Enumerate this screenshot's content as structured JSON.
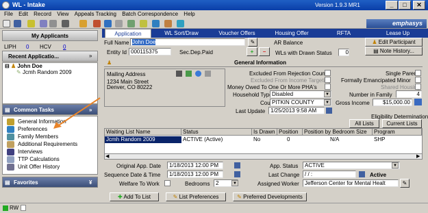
{
  "window": {
    "title": "WL - Intake",
    "version": "Version 1.9.3 MR1"
  },
  "menu": [
    "File",
    "Edit",
    "Record",
    "View",
    "Appeals Tracking",
    "Batch Correspondence",
    "Help"
  ],
  "brand": "emphasys",
  "left": {
    "my_applicants": "My Applicants",
    "counts": {
      "liph_label": "LIPH",
      "liph_value": "0",
      "hcv_label": "HCV",
      "hcv_value": "0"
    },
    "recent": "Recent Applicatio...",
    "tree": {
      "parent": "John Doe",
      "child": "Jcmh Random 2009"
    },
    "common_tasks": "Common Tasks",
    "tasks": [
      "General Information",
      "Preferences",
      "Family Members",
      "Additional Requirements",
      "Interviews",
      "TTP Calculations",
      "Unit Offer History"
    ],
    "favorites": "Favorites"
  },
  "tabs": [
    "Application",
    "WL Sort/Draw",
    "Voucher Offers",
    "Housing Offer",
    "RFTA",
    "Lease Up"
  ],
  "header": {
    "full_name_label": "Full Name",
    "full_name": "John Doe",
    "ar_balance": "AR Balance",
    "edit_participant": "Edit Participant",
    "entity_id_label": "Entity Id",
    "entity_id": "000115375",
    "sec_dep": "Sec.Dep.Paid",
    "wls_label": "WLs with Drawn Status",
    "wls_value": "0",
    "note_history": "Note History..."
  },
  "general": {
    "title": "General Information",
    "mailing_address": "Mailing Address",
    "address1": "1234 Main Street",
    "address2": "Denver, CO  80222",
    "excluded_rejection": "Excluded From Rejection Count",
    "excluded_income": "Excluded From Income Targeting",
    "money_owed": "Money Owed To One Or More PHA's",
    "household_type_label": "Household Type",
    "household_type": "Disabled",
    "county_label": "County",
    "county": "PITKIN COUNTY",
    "last_update_label": "Last Update",
    "last_update": "1/25/2013  9:58 AM",
    "single_parent": "Single Parent",
    "emancipated": "Formally Emancipated Minor",
    "shared_housing": "Shared Housing",
    "num_family_label": "Number in Family",
    "num_family": "4",
    "gross_income_label": "Gross Income",
    "gross_income": "$15,000.00",
    "eligibility": "Eligibility Determination",
    "all_lists": "All Lists",
    "current_lists": "Current Lists"
  },
  "grid": {
    "headers": [
      "Waiting List Name",
      "Status",
      "Is Drawn",
      "Position",
      "Position by Bedroom Size",
      "Program"
    ],
    "rows": [
      [
        "Jcmh Random 2009",
        "ACTIVE (Active)",
        "No",
        "0",
        "N/A",
        "SHP"
      ]
    ]
  },
  "bottom": {
    "orig_app_label": "Original App. Date",
    "orig_app": "1/18/2013 12:00 PM",
    "seq_label": "Sequence Date & Time",
    "seq": "1/18/2013 12:00 PM",
    "welfare": "Welfare To Work",
    "bedrooms_label": "Bedrooms",
    "bedrooms": "2",
    "app_status_label": "App. Status",
    "app_status": "ACTIVE",
    "last_change_label": "Last Change",
    "last_change": " / /  :",
    "active": "Active",
    "assigned_label": "Assigned Worker",
    "assigned": "Jefferson Center for Mental Healt"
  },
  "buttons": {
    "add_to_list": "Add To List",
    "list_prefs": "List Preferences",
    "pref_dev": "Preferred Developments"
  },
  "statusbar": {
    "rw": "RW"
  }
}
